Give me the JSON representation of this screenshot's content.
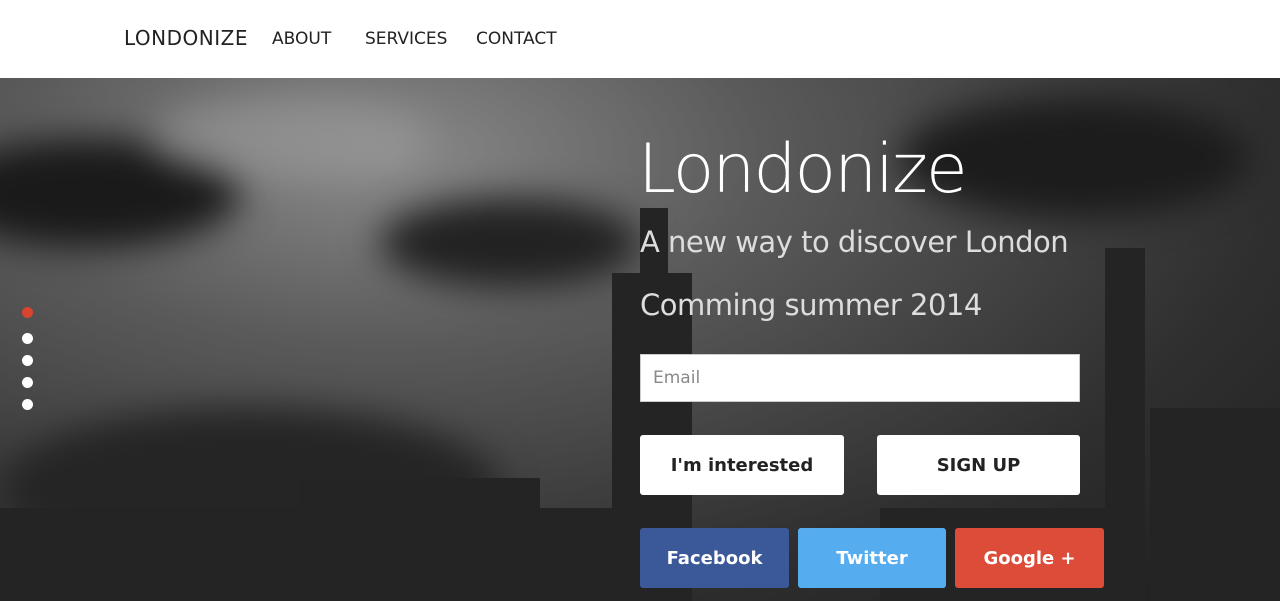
{
  "nav": {
    "brand": "LONDONIZE",
    "links": [
      "ABOUT",
      "SERVICES",
      "CONTACT"
    ]
  },
  "hero": {
    "title": "Londonize",
    "subtitle": "A new way to discover London",
    "coming": "Comming summer 2014",
    "email_placeholder": "Email",
    "interested_label": "I'm interested",
    "signup_label": "SIGN UP",
    "social": {
      "facebook": "Facebook",
      "twitter": "Twitter",
      "google": "Google +"
    }
  },
  "slider": {
    "count": 5,
    "active_index": 0
  },
  "colors": {
    "accent": "#d9442f",
    "facebook": "#3b5998",
    "twitter": "#55acee",
    "google": "#dd4b39"
  }
}
